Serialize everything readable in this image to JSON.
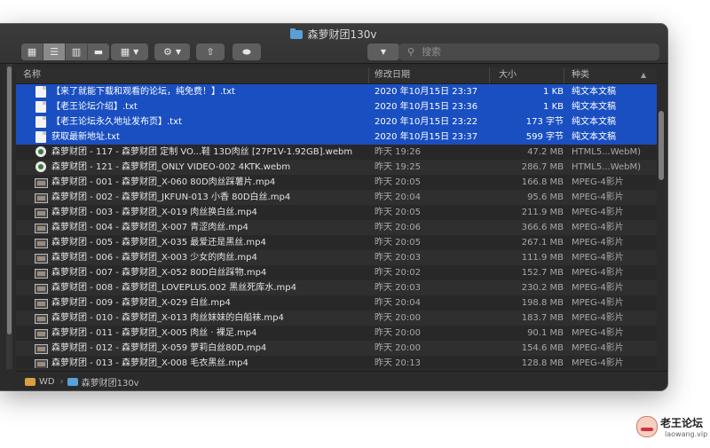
{
  "window": {
    "title": "森萝财团130v"
  },
  "toolbar": {
    "view_icons": [
      "icon-view-icon",
      "list-view-icon",
      "column-view-icon",
      "gallery-view-icon"
    ],
    "group_icon": "group-icon",
    "action_icon": "gear-icon",
    "share_icon": "share-icon",
    "tag_icon": "tag-icon"
  },
  "search": {
    "placeholder": "搜索"
  },
  "columns": {
    "name": "名称",
    "date": "修改日期",
    "size": "大小",
    "kind": "种类"
  },
  "files": [
    {
      "name": "【来了就能下载和观看的论坛，纯免费！】.txt",
      "date": "2020 年10月15日 23:37",
      "size": "1 KB",
      "kind": "纯文本文稿",
      "icon": "text-file-icon",
      "selected": true
    },
    {
      "name": "【老王论坛介绍】.txt",
      "date": "2020 年10月15日 23:36",
      "size": "1 KB",
      "kind": "纯文本文稿",
      "icon": "text-file-icon",
      "selected": true
    },
    {
      "name": "【老王论坛永久地址发布页】.txt",
      "date": "2020 年10月15日 23:22",
      "size": "173 字节",
      "kind": "纯文本文稿",
      "icon": "text-file-icon",
      "selected": true
    },
    {
      "name": "获取最新地址.txt",
      "date": "2020 年10月15日 23:37",
      "size": "599 字节",
      "kind": "纯文本文稿",
      "icon": "text-file-icon",
      "selected": true
    },
    {
      "name": "森萝财团 - 117 - 森萝财团 定制 VO...鞋 13D肉丝 [27P1V-1.92GB].webm",
      "date": "昨天 19:26",
      "size": "47.2 MB",
      "kind": "HTML5...WebM)",
      "icon": "webm-file-icon",
      "selected": false
    },
    {
      "name": "森萝财团 - 121 - 森萝财团_ONLY VIDEO-002 4KTK.webm",
      "date": "昨天 19:25",
      "size": "286.7 MB",
      "kind": "HTML5...WebM)",
      "icon": "webm-file-icon",
      "selected": false
    },
    {
      "name": "森萝财团 - 001 - 森萝财团_X-060 80D肉丝踩薯片.mp4",
      "date": "昨天 20:05",
      "size": "166.8 MB",
      "kind": "MPEG-4影片",
      "icon": "video-thumbnail-icon",
      "selected": false
    },
    {
      "name": "森萝财团 - 002 - 森萝财团_JKFUN-013 小香 80D白丝.mp4",
      "date": "昨天 20:04",
      "size": "95.6 MB",
      "kind": "MPEG-4影片",
      "icon": "video-thumbnail-icon",
      "selected": false
    },
    {
      "name": "森萝财团 - 003 - 森萝财团_X-019 肉丝换白丝.mp4",
      "date": "昨天 20:05",
      "size": "211.9 MB",
      "kind": "MPEG-4影片",
      "icon": "video-thumbnail-icon",
      "selected": false
    },
    {
      "name": "森萝财团 - 004 - 森萝财团_X-007 青涩肉丝.mp4",
      "date": "昨天 20:06",
      "size": "366.6 MB",
      "kind": "MPEG-4影片",
      "icon": "video-thumbnail-icon",
      "selected": false
    },
    {
      "name": "森萝财团 - 005 - 森萝财团_X-035 最爱还是黑丝.mp4",
      "date": "昨天 20:05",
      "size": "267.1 MB",
      "kind": "MPEG-4影片",
      "icon": "video-thumbnail-icon",
      "selected": false
    },
    {
      "name": "森萝财团 - 006 - 森萝财团_X-003 少女的肉丝.mp4",
      "date": "昨天 20:03",
      "size": "111.9 MB",
      "kind": "MPEG-4影片",
      "icon": "video-thumbnail-icon",
      "selected": false
    },
    {
      "name": "森萝财团 - 007 - 森萝财团_X-052 80D白丝踩物.mp4",
      "date": "昨天 20:02",
      "size": "152.7 MB",
      "kind": "MPEG-4影片",
      "icon": "video-thumbnail-icon",
      "selected": false
    },
    {
      "name": "森萝财团 - 008 - 森萝财团_LOVEPLUS.002 黑丝死库水.mp4",
      "date": "昨天 20:03",
      "size": "230.2 MB",
      "kind": "MPEG-4影片",
      "icon": "video-thumbnail-icon",
      "selected": false
    },
    {
      "name": "森萝财团 - 009 - 森萝财团_X-029 白丝.mp4",
      "date": "昨天 20:04",
      "size": "198.8 MB",
      "kind": "MPEG-4影片",
      "icon": "video-thumbnail-icon",
      "selected": false
    },
    {
      "name": "森萝财团 - 010 - 森萝财团_X-013 肉丝妹妹的白船袜.mp4",
      "date": "昨天 20:00",
      "size": "183.7 MB",
      "kind": "MPEG-4影片",
      "icon": "video-thumbnail-icon",
      "selected": false
    },
    {
      "name": "森萝财团 - 011 - 森萝财团_X-005 肉丝 · 裸足.mp4",
      "date": "昨天 20:00",
      "size": "90.1 MB",
      "kind": "MPEG-4影片",
      "icon": "video-thumbnail-icon",
      "selected": false
    },
    {
      "name": "森萝财团 - 012 - 森萝财团_X-059 萝莉白丝80D.mp4",
      "date": "昨天 20:00",
      "size": "154.6 MB",
      "kind": "MPEG-4影片",
      "icon": "video-thumbnail-icon",
      "selected": false
    },
    {
      "name": "森萝财团 - 013 - 森萝财团_X-008 毛衣黑丝.mp4",
      "date": "昨天 20:13",
      "size": "128.8 MB",
      "kind": "MPEG-4影片",
      "icon": "video-thumbnail-icon",
      "selected": false
    }
  ],
  "pathbar": {
    "root": "WD",
    "folder": "森萝财团130v"
  },
  "watermark": {
    "title": "老王论坛",
    "url": "laowang.vip"
  },
  "colors": {
    "selection": "#1a4fc2",
    "window_bg": "#2b2b2b",
    "folder_blue": "#5aa0d8"
  }
}
